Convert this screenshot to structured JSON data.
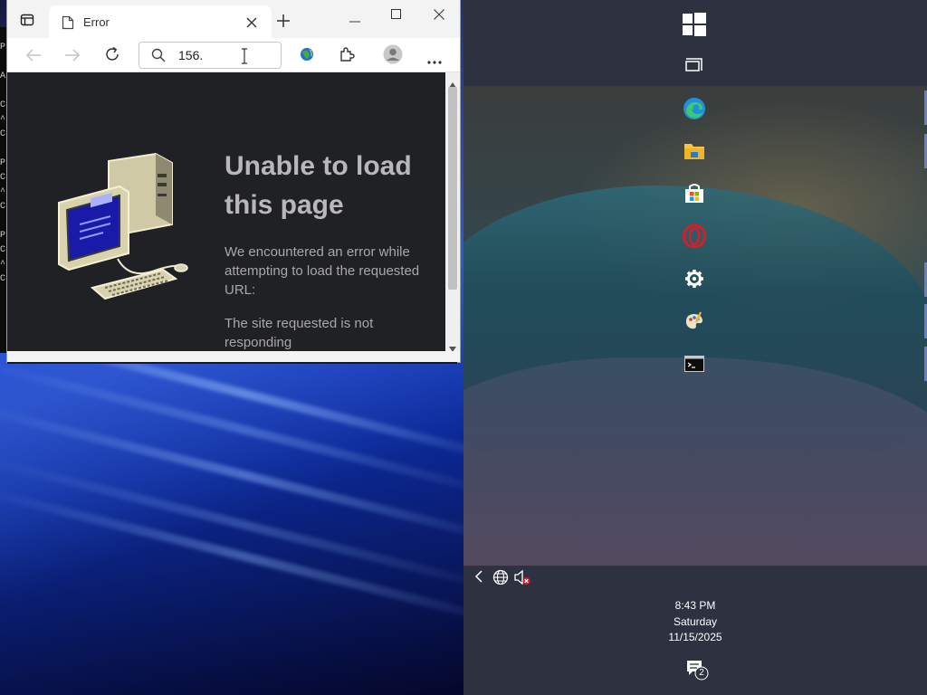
{
  "browser": {
    "tab_title": "Error",
    "address_value": "156.",
    "error": {
      "title": "Unable to load this page",
      "description": "We encountered an error while attempting to load the requested URL:",
      "detail": "The site requested is not responding"
    }
  },
  "left_strip_chars": [
    "P",
    "A",
    "C",
    "^",
    "C",
    "P",
    "C",
    "^",
    "C",
    "P",
    "C",
    "^",
    "C"
  ],
  "taskbar": {
    "icons": [
      "windows-start-icon",
      "task-view-icon",
      "edge-icon",
      "file-explorer-icon",
      "microsoft-store-icon",
      "opera-icon",
      "settings-gear-icon",
      "paint-palette-icon",
      "terminal-icon"
    ]
  },
  "tray": {
    "time": "8:43 PM",
    "day": "Saturday",
    "date": "11/15/2025",
    "notification_count": "2"
  },
  "colors": {
    "browser_content_bg": "#202124",
    "edge_blue": "#1f8fe0",
    "opera_red": "#d31f2b"
  }
}
